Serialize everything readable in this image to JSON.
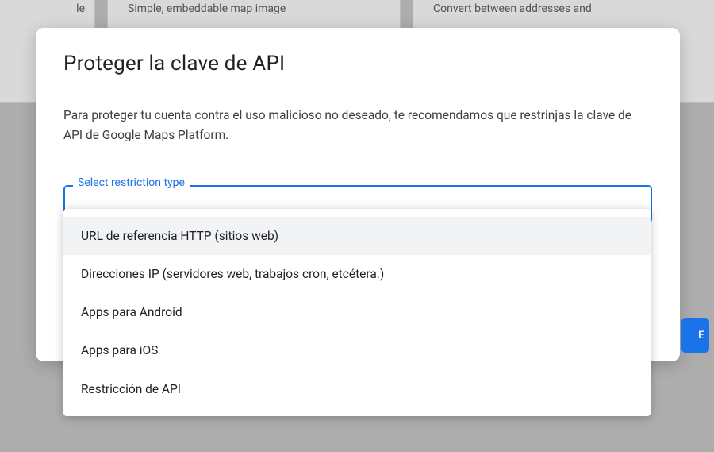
{
  "background": {
    "card_left": "le",
    "card_center": "Simple, embeddable map image",
    "card_right": "Convert between addresses and",
    "button_fragment": "E"
  },
  "dialog": {
    "title": "Proteger la clave de API",
    "description": "Para proteger tu cuenta contra el uso malicioso no deseado, te recomendamos que restrinjas la clave de API de Google Maps Platform.",
    "select": {
      "label": "Select restriction type",
      "options": [
        "URL de referencia HTTP (sitios web)",
        "Direcciones IP (servidores web, trabajos cron, etcétera.)",
        "Apps para Android",
        "Apps para iOS",
        "Restricción de API"
      ]
    }
  }
}
